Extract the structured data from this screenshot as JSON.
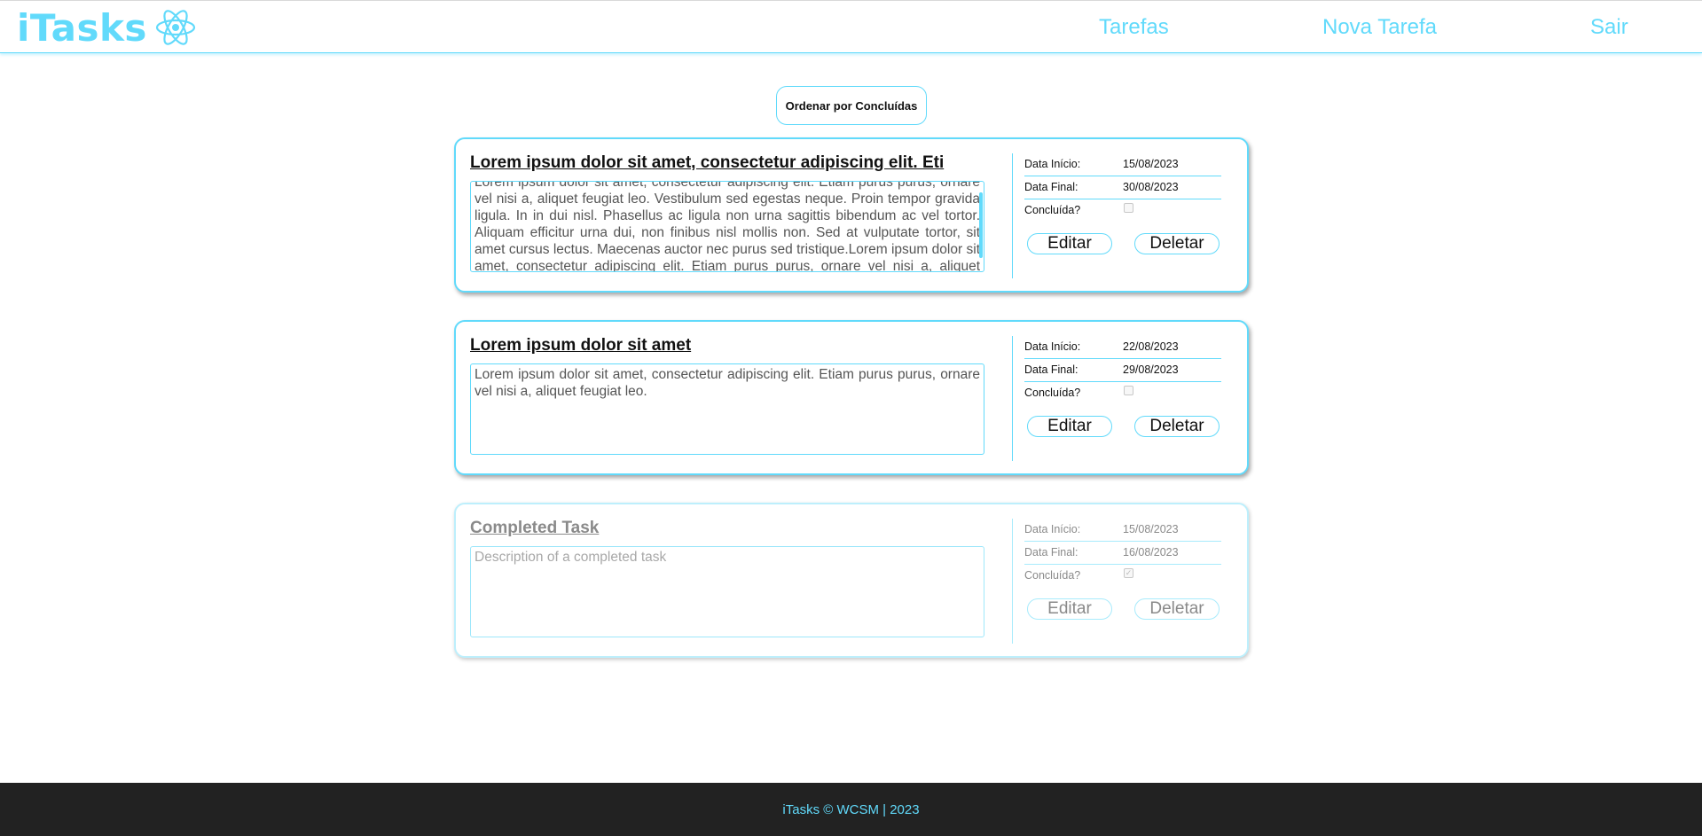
{
  "header": {
    "brand": "iTasks",
    "logo_icon": "react-atom-icon",
    "nav": [
      "Tarefas",
      "Nova Tarefa",
      "Sair"
    ]
  },
  "sort_button": "Ordenar por Concluídas",
  "labels": {
    "start": "Data Início:",
    "end": "Data Final:",
    "done": "Concluída?",
    "edit": "Editar",
    "delete": "Deletar"
  },
  "tasks": [
    {
      "title": "Lorem ipsum dolor sit amet, consectetur adipiscing elit. Eti",
      "description": "Lorem ipsum dolor sit amet, consectetur adipiscing elit. Etiam purus purus, ornare vel nisi a, aliquet feugiat leo. Vestibulum sed egestas neque. Proin tempor gravida ligula. In in dui nisl. Phasellus ac ligula non urna sagittis bibendum ac vel tortor. Aliquam efficitur urna dui, non finibus nisl mollis non. Sed at vulputate tortor, sit amet cursus lectus. Maecenas auctor nec purus sed tristique.Lorem ipsum dolor sit amet, consectetur adipiscing elit. Etiam purus purus, ornare vel nisi a, aliquet feugiat leo.",
      "start": "15/08/2023",
      "end": "30/08/2023",
      "completed": false
    },
    {
      "title": "Lorem ipsum dolor sit amet",
      "description": "Lorem ipsum dolor sit amet, consectetur adipiscing elit. Etiam purus purus, ornare vel nisi a, aliquet feugiat leo.",
      "start": "22/08/2023",
      "end": "29/08/2023",
      "completed": false
    },
    {
      "title": "Completed Task",
      "description": "Description of a completed task",
      "start": "15/08/2023",
      "end": "16/08/2023",
      "completed": true
    }
  ],
  "footer": "iTasks © WCSM | 2023",
  "colors": {
    "accent": "#61dafb",
    "footer_bg": "#222222",
    "muted": "#8a8a8a"
  }
}
